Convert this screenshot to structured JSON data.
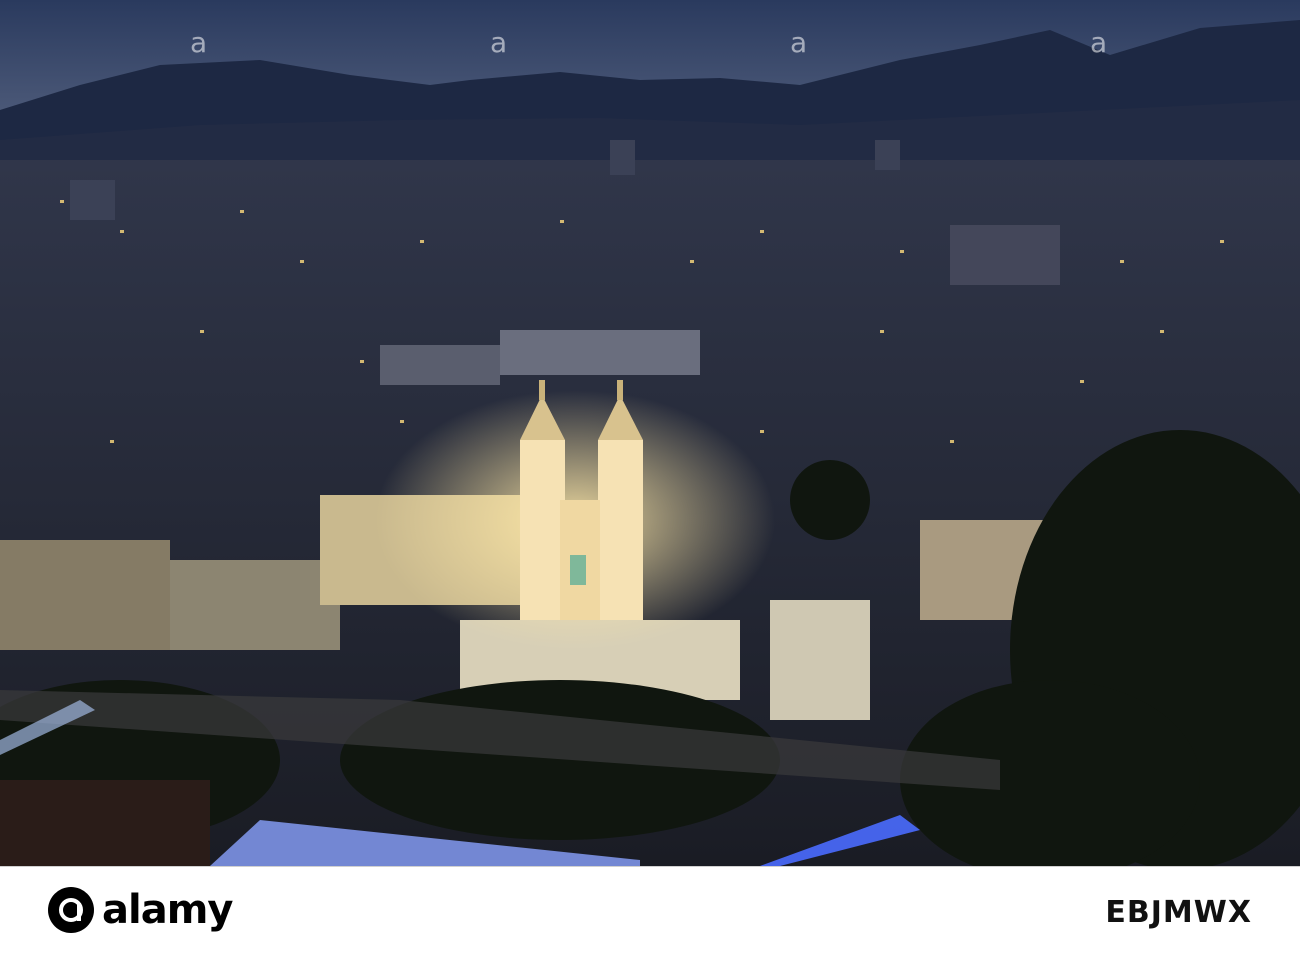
{
  "photo": {
    "subject": "Graz old town at night with illuminated twin-tower church (Mariahilfkirche), hills and Murinsel bridge",
    "colors": {
      "sky": "#2c3a5c",
      "hills": "#1c2741",
      "city": "#262834",
      "glow": "#f4d27a",
      "bridge": "#4a6cff"
    }
  },
  "watermark": {
    "text": "a"
  },
  "footer": {
    "brand_name": "alamy",
    "brand_tld": "",
    "image_id": "EBJMWX"
  }
}
